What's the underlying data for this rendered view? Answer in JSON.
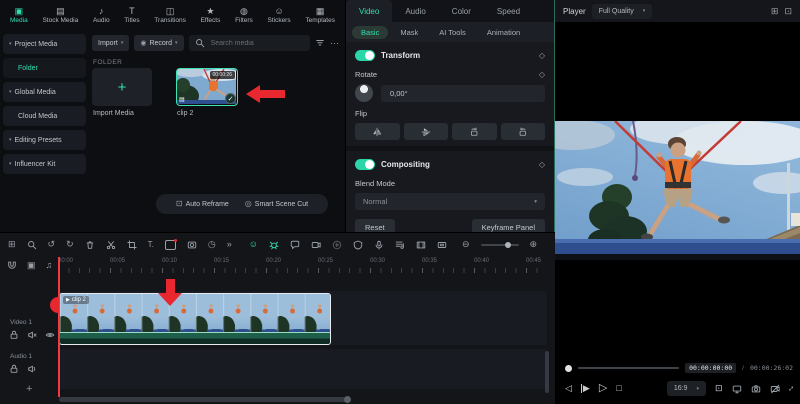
{
  "colors": {
    "accent": "#32dfb3",
    "annotation_red": "#e8282e"
  },
  "glyphs": {
    "caret_down": "▾",
    "more_h": "⋯",
    "record_dot": "◉",
    "plus": "+",
    "check": "✓",
    "film_badge": "▤",
    "auto_reframe": "⊡",
    "scene_cut": "◎",
    "diamond": "◇",
    "select": "⊞",
    "undo": "↺",
    "redo": "↻",
    "text_tool": "T.",
    "clock": "◷",
    "overflow": "»",
    "smiley": "☺",
    "zoom_out": "⊖",
    "zoom_in": "⊕",
    "track_film": "▣",
    "track_audio": "♫",
    "grid_view": "⊞",
    "pip": "⊡",
    "step_back": "◁",
    "step_fwd": "▶",
    "play": "▷",
    "stop": "□",
    "marker_box": "⊡",
    "fullscreen": "↕"
  },
  "top_tabs": {
    "items": [
      {
        "label": "Media",
        "glyph": "▣",
        "active": true
      },
      {
        "label": "Stock Media",
        "glyph": "▤"
      },
      {
        "label": "Audio",
        "glyph": "♪"
      },
      {
        "label": "Titles",
        "glyph": "T"
      },
      {
        "label": "Transitions",
        "glyph": "◫"
      },
      {
        "label": "Effects",
        "glyph": "★"
      },
      {
        "label": "Filters",
        "glyph": "◍"
      },
      {
        "label": "Stickers",
        "glyph": "☺"
      },
      {
        "label": "Templates",
        "glyph": "▦"
      }
    ]
  },
  "sidebar": {
    "items": [
      {
        "label": "Project Media",
        "caret": "▾"
      },
      {
        "label": "Folder",
        "active": true
      },
      {
        "label": "Global Media",
        "caret": "▾"
      },
      {
        "label": "Cloud Media"
      },
      {
        "label": "Editing Presets",
        "caret": "▾"
      },
      {
        "label": "Influencer Kit",
        "caret": "▾"
      }
    ]
  },
  "media_panel": {
    "import_button": "Import",
    "record_button": "Record",
    "search_placeholder": "Search media",
    "section_label": "FOLDER",
    "import_tile_label": "Import Media",
    "clip_name": "clip 2",
    "clip_duration": "00:00:26",
    "auto_reframe": "Auto Reframe",
    "smart_scene_cut": "Smart Scene Cut"
  },
  "inspector": {
    "tabs": [
      {
        "label": "Video",
        "active": true
      },
      {
        "label": "Audio"
      },
      {
        "label": "Color"
      },
      {
        "label": "Speed"
      }
    ],
    "subtabs": [
      {
        "label": "Basic",
        "active": true
      },
      {
        "label": "Mask"
      },
      {
        "label": "AI Tools"
      },
      {
        "label": "Animation"
      }
    ],
    "transform_title": "Transform",
    "rotate_label": "Rotate",
    "rotate_value": "0,00°",
    "flip_label": "Flip",
    "compositing_title": "Compositing",
    "blend_mode_label": "Blend Mode",
    "blend_mode_value": "Normal",
    "reset_button": "Reset",
    "keyframe_button": "Keyframe Panel"
  },
  "player": {
    "title": "Player",
    "quality": "Full Quality",
    "current_time": "00:00:00:00",
    "time_separator": "/",
    "total_time": "00:00:26:02",
    "aspect_ratio": "16:9"
  },
  "timeline": {
    "ruler_ticks": [
      "00:00",
      "00:05",
      "00:10",
      "00:15",
      "00:20",
      "00:25",
      "00:30",
      "00:35",
      "00:40",
      "00:45"
    ],
    "clip_label": "clip 2",
    "video_track_label": "Video 1",
    "audio_track_label": "Audio 1",
    "add_track": "+"
  }
}
